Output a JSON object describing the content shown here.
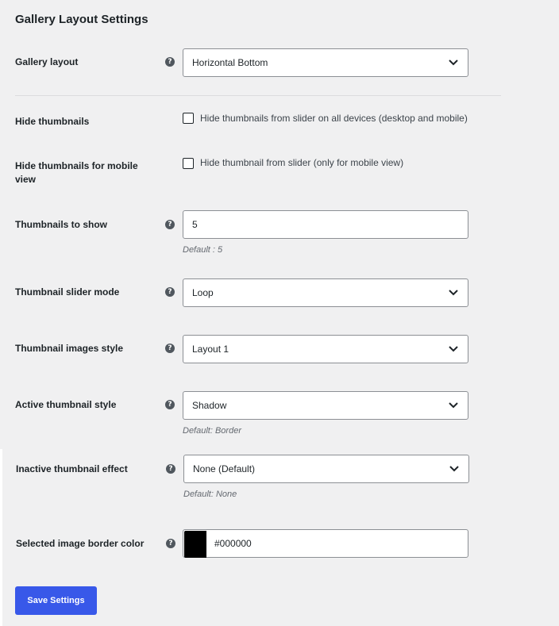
{
  "section_title": "Gallery Layout Settings",
  "help_glyph": "?",
  "fields": {
    "gallery_layout": {
      "label": "Gallery layout",
      "value": "Horizontal Bottom"
    },
    "hide_thumbnails": {
      "label": "Hide thumbnails",
      "checkbox_label": "Hide thumbnails from slider on all devices (desktop and mobile)",
      "checked": false
    },
    "hide_thumbnails_mobile": {
      "label_line1": "Hide thumbnails for mobile",
      "label_line2": "view",
      "checkbox_label": "Hide thumbnail from slider (only for mobile view)",
      "checked": false
    },
    "thumbnails_to_show": {
      "label": "Thumbnails to show",
      "value": "5",
      "hint": "Default : 5"
    },
    "thumbnail_slider_mode": {
      "label": "Thumbnail slider mode",
      "value": "Loop"
    },
    "thumbnail_images_style": {
      "label": "Thumbnail images style",
      "value": "Layout 1"
    },
    "active_thumbnail_style": {
      "label": "Active thumbnail style",
      "value": "Shadow",
      "hint": "Default: Border"
    },
    "inactive_thumbnail_effect": {
      "label": "Inactive thumbnail effect",
      "value": "None (Default)",
      "hint": "Default: None"
    },
    "selected_image_border_color": {
      "label": "Selected image border color",
      "value": "#000000",
      "swatch_color": "#000000"
    }
  },
  "save_button": {
    "label": "Save Settings",
    "color": "#3858e9"
  },
  "icons": {
    "help": "help-circle-icon",
    "dropdown": "chevron-down-icon"
  }
}
